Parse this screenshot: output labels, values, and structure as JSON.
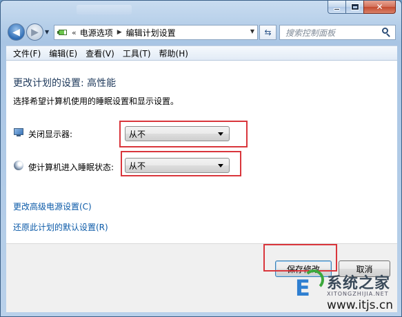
{
  "window": {
    "close_glyph": "✕"
  },
  "nav": {
    "back_glyph": "◀",
    "forward_glyph": "▶",
    "address": {
      "overflow": "«",
      "crumbs": [
        "电源选项",
        "编辑计划设置"
      ]
    },
    "search_placeholder": "搜索控制面板"
  },
  "menu": [
    "文件(F)",
    "编辑(E)",
    "查看(V)",
    "工具(T)",
    "帮助(H)"
  ],
  "content": {
    "heading": "更改计划的设置: 高性能",
    "description": "选择希望计算机使用的睡眠设置和显示设置。",
    "settings": [
      {
        "label": "关闭显示器:",
        "value": "从不",
        "icon": "monitor-icon"
      },
      {
        "label": "使计算机进入睡眠状态:",
        "value": "从不",
        "icon": "moon-icon"
      }
    ],
    "links": [
      "更改高级电源设置(C)",
      "还原此计划的默认设置(R)"
    ]
  },
  "footer": {
    "save_label": "保存修改",
    "cancel_label": "取消"
  },
  "watermark": {
    "name": "系统之家",
    "pinyin": "XITONGZHIJIA.NET",
    "url": "www.itjs.cn"
  },
  "colors": {
    "highlight": "#d9353b",
    "link": "#0b5aa8",
    "heading": "#1e395b"
  }
}
